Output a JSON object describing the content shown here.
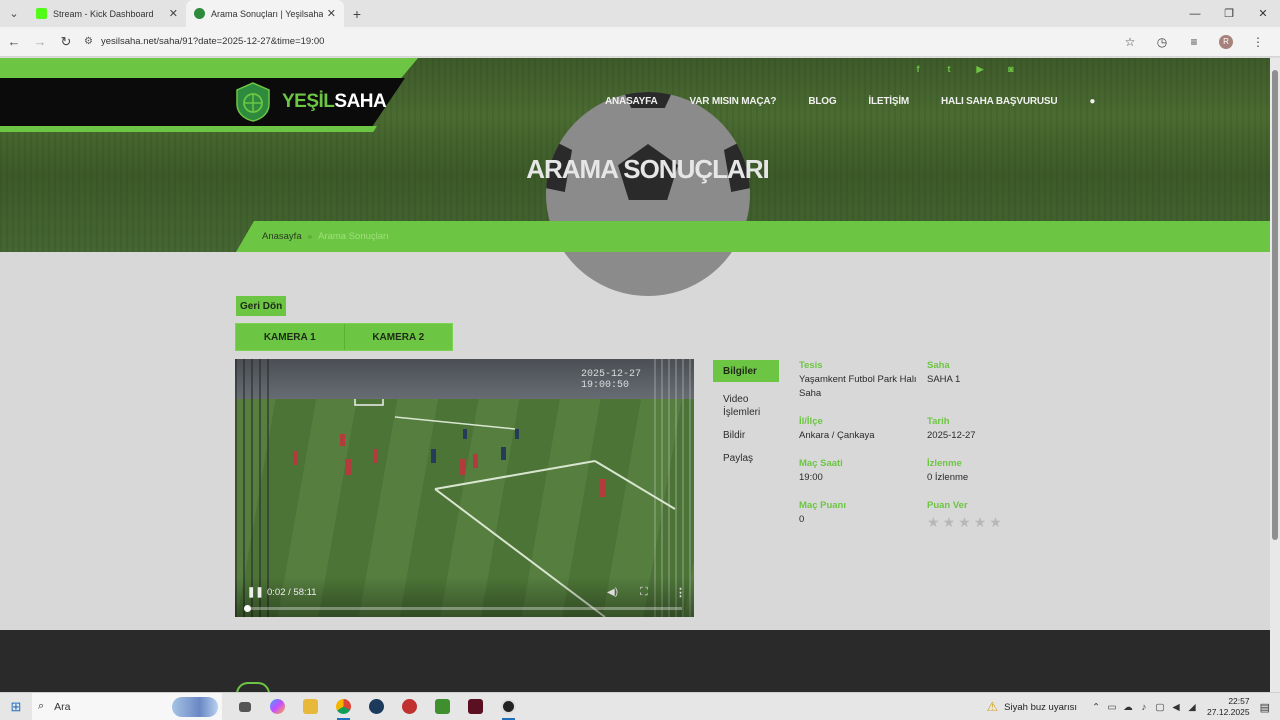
{
  "browser": {
    "tabs": [
      {
        "title": "Stream - Kick Dashboard",
        "favicon_color": "#53fc18",
        "active": false
      },
      {
        "title": "Arama Sonuçları | Yeşilsaha",
        "favicon_color": "#2e8b3e",
        "active": true
      }
    ],
    "url": "yesilsaha.net/saha/91?date=2025-12-27&time=19:00"
  },
  "site": {
    "logo_prefix": "YEŞİL",
    "logo_suffix": "SAHA",
    "social": [
      "f",
      "t",
      "▶",
      "◙"
    ],
    "nav": [
      "ANASAYFA",
      "VAR MISIN MAÇA?",
      "BLOG",
      "İLETİŞİM",
      "HALI SAHA BAŞVURUSU"
    ],
    "hero_title": "ARAMA SONUÇLARI",
    "breadcrumb": {
      "home": "Anasayfa",
      "separator": "»",
      "current": "Arama Sonuçları"
    },
    "accent": "#6cc643"
  },
  "content": {
    "back_label": "Geri Dön",
    "camera_tabs": [
      "KAMERA 1",
      "KAMERA 2"
    ],
    "video": {
      "timestamp": "2025-12-27 19:00:50",
      "time_display": "0:02 / 58:11",
      "progress_percent": 0.06
    },
    "side_menu": [
      "Bilgiler",
      "Video İşlemleri",
      "Bildir",
      "Paylaş"
    ],
    "info": {
      "tesis_label": "Tesis",
      "tesis": "Yaşamkent Futbol Park Halı Saha",
      "saha_label": "Saha",
      "saha": "SAHA 1",
      "ilce_label": "İl/İlçe",
      "ilce": "Ankara / Çankaya",
      "tarih_label": "Tarih",
      "tarih": "2025-12-27",
      "mac_saati_label": "Maç Saati",
      "mac_saati": "19:00",
      "izlenme_label": "İzlenme",
      "izlenme": "0 İzlenme",
      "mac_puani_label": "Maç Puanı",
      "mac_puani": "0",
      "puan_ver_label": "Puan Ver",
      "stars": 5
    }
  },
  "taskbar": {
    "search_placeholder": "Ara",
    "weather": "Siyah buz uyarısı",
    "time": "22:57",
    "date": "27.12.2025"
  }
}
